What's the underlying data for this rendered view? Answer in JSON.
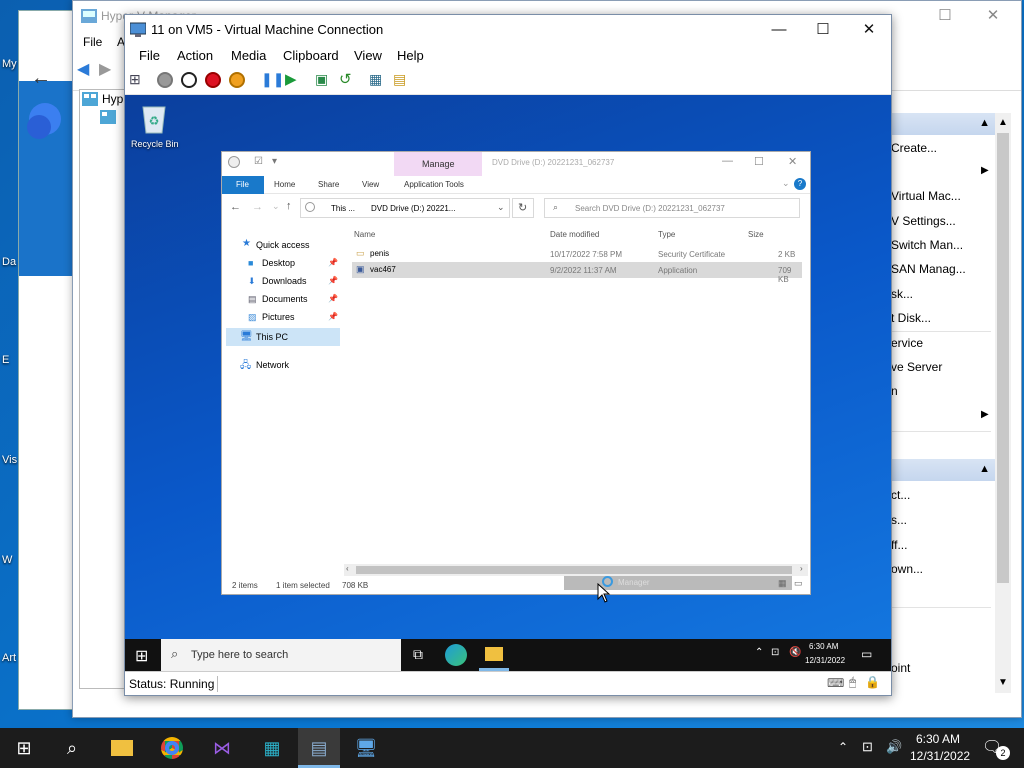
{
  "host_desktop": {
    "labels": [
      "My",
      "Da",
      "E",
      "Vis",
      "W",
      "Art"
    ]
  },
  "hyperv_manager": {
    "title": "Hyper-V Manager",
    "menu": [
      "File",
      "A"
    ],
    "tree_label": "Hyp",
    "actions": [
      "Create...",
      "Virtual Mac...",
      "V Settings...",
      "Switch Man...",
      "SAN Manag...",
      "sk...",
      "t Disk...",
      "ervice",
      "ve Server",
      "n",
      "ct...",
      "s...",
      "ff...",
      "own...",
      "oint"
    ]
  },
  "vm_connection": {
    "title": "11 on VM5 - Virtual Machine Connection",
    "menu": [
      "File",
      "Action",
      "Media",
      "Clipboard",
      "View",
      "Help"
    ],
    "status": "Status: Running"
  },
  "guest": {
    "recycle_bin_label": "Recycle Bin",
    "explorer": {
      "manage_tab": "Manage",
      "title": "DVD Drive (D:) 20221231_062737",
      "tabs": [
        "File",
        "Home",
        "Share",
        "View",
        "Application Tools"
      ],
      "address": [
        "This ...",
        "DVD Drive (D:) 20221..."
      ],
      "search_placeholder": "Search DVD Drive (D:) 20221231_062737",
      "nav": {
        "quick_access": "Quick access",
        "desktop": "Desktop",
        "downloads": "Downloads",
        "documents": "Documents",
        "pictures": "Pictures",
        "this_pc": "This PC",
        "network": "Network"
      },
      "columns": [
        "Name",
        "Date modified",
        "Type",
        "Size"
      ],
      "files": [
        {
          "name": "penis",
          "date": "10/17/2022 7:58 PM",
          "type": "Security Certificate",
          "size": "2 KB"
        },
        {
          "name": "vac467",
          "date": "9/2/2022 11:37 AM",
          "type": "Application",
          "size": "709 KB"
        }
      ],
      "status_items": "2 items",
      "status_selected": "1 item selected",
      "status_size": "708 KB",
      "drag_ghost": "Manager"
    },
    "taskbar": {
      "search_placeholder": "Type here to search",
      "time": "6:30 AM",
      "date": "12/31/2022"
    }
  },
  "host_taskbar": {
    "time": "6:30 AM",
    "date": "12/31/2022",
    "notification_count": "2"
  }
}
